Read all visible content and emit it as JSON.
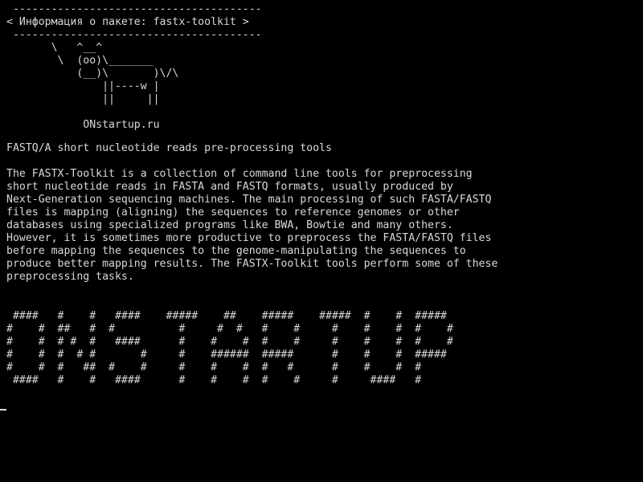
{
  "terminal": {
    "cowsay": [
      " ---------------------------------------",
      "< Информация о пакете: fastx-toolkit >",
      " ---------------------------------------",
      "       \\   ^__^",
      "        \\  (oo)\\_______",
      "           (__)\\       )\\/\\",
      "               ||----w |",
      "               ||     ||",
      "",
      "            ONstartup.ru"
    ],
    "summary": "FASTQ/A short nucleotide reads pre-processing tools",
    "description": [
      "The FASTX-Toolkit is a collection of command line tools for preprocessing",
      "short nucleotide reads in FASTA and FASTQ formats, usually produced by",
      "Next-Generation sequencing machines. The main processing of such FASTA/FASTQ",
      "files is mapping (aligning) the sequences to reference genomes or other",
      "databases using specialized programs like BWA, Bowtie and many others.",
      "However, it is sometimes more productive to preprocess the FASTA/FASTQ files",
      "before mapping the sequences to the genome-manipulating the sequences to",
      "produce better mapping results. The FASTX-Toolkit tools perform some of these",
      "preprocessing tasks."
    ],
    "banner": [
      " ####   #    #   ####    #####    ##    #####    #####  #    #  #####",
      "#    #  ##   #  #          #     #  #   #    #     #    #    #  #    #",
      "#    #  # #  #   ####      #    #    #  #    #     #    #    #  #    #",
      "#    #  #  # #       #     #    ######  #####      #    #    #  #####",
      "#    #  #   ##  #    #     #    #    #  #   #      #    #    #  #",
      " ####   #    #   ####      #    #    #  #    #     #     ####   #"
    ]
  }
}
